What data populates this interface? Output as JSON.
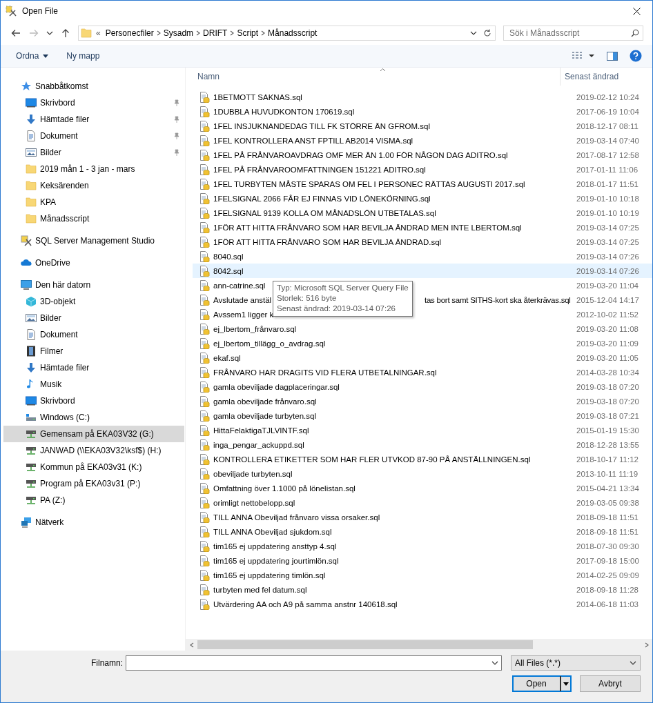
{
  "window": {
    "title": "Open File"
  },
  "address": {
    "overflow": "«",
    "path": [
      "Personecfiler",
      "Sysadm",
      "DRIFT",
      "Script",
      "Månadsscript"
    ]
  },
  "search": {
    "placeholder": "Sök i Månadsscript"
  },
  "toolbar": {
    "organize": "Ordna",
    "new_folder": "Ny mapp"
  },
  "sidebar": {
    "items": [
      {
        "label": "Snabbåtkomst",
        "kind": "star",
        "selected": false,
        "children": [
          {
            "label": "Skrivbord",
            "kind": "desktop",
            "pinned": true,
            "selected": false
          },
          {
            "label": "Hämtade filer",
            "kind": "download",
            "pinned": true,
            "selected": false
          },
          {
            "label": "Dokument",
            "kind": "document",
            "pinned": true,
            "selected": false
          },
          {
            "label": "Bilder",
            "kind": "pictures",
            "pinned": true,
            "selected": false
          },
          {
            "label": "2019 mån 1 - 3 jan - mars",
            "kind": "folder",
            "pinned": false,
            "selected": false
          },
          {
            "label": "Keksärenden",
            "kind": "folder",
            "pinned": false,
            "selected": false
          },
          {
            "label": "KPA",
            "kind": "folder",
            "pinned": false,
            "selected": false
          },
          {
            "label": "Månadsscript",
            "kind": "folder",
            "pinned": false,
            "selected": false
          }
        ]
      },
      {
        "label": "SQL Server Management Studio",
        "kind": "app",
        "selected": false
      },
      {
        "label": "OneDrive",
        "kind": "cloud",
        "selected": false
      },
      {
        "label": "Den här datorn",
        "kind": "computer",
        "selected": false,
        "children": [
          {
            "label": "3D-objekt",
            "kind": "cube",
            "selected": false
          },
          {
            "label": "Bilder",
            "kind": "pictures",
            "selected": false
          },
          {
            "label": "Dokument",
            "kind": "document",
            "selected": false
          },
          {
            "label": "Filmer",
            "kind": "film",
            "selected": false
          },
          {
            "label": "Hämtade filer",
            "kind": "download",
            "selected": false
          },
          {
            "label": "Musik",
            "kind": "music",
            "selected": false
          },
          {
            "label": "Skrivbord",
            "kind": "desktop",
            "selected": false
          },
          {
            "label": "Windows (C:)",
            "kind": "drive",
            "selected": false
          },
          {
            "label": "Gemensam på EKA03V32 (G:)",
            "kind": "netdrive",
            "selected": true
          },
          {
            "label": "JANWAD (\\\\EKA03V32\\ksf$) (H:)",
            "kind": "netdrive",
            "selected": false
          },
          {
            "label": "Kommun på EKA03v31 (K:)",
            "kind": "netdrive",
            "selected": false
          },
          {
            "label": "Program på EKA03v31 (P:)",
            "kind": "netdrive",
            "selected": false
          },
          {
            "label": "PA (Z:)",
            "kind": "netdrive",
            "selected": false
          }
        ]
      },
      {
        "label": "Nätverk",
        "kind": "network",
        "selected": false
      }
    ]
  },
  "columns": {
    "name": "Namn",
    "modified": "Senast ändrad"
  },
  "files": [
    {
      "name": "1BETMOTT SAKNAS.sql",
      "modified": "2019-02-12 10:24",
      "hovered": false
    },
    {
      "name": "1DUBBLA HUVUDKONTON 170619.sql",
      "modified": "2017-06-19 10:04",
      "hovered": false
    },
    {
      "name": "1FEL INSJUKNANDEDAG TILL FK STÖRRE ÄN GFROM.sql",
      "modified": "2018-12-17 08:11",
      "hovered": false
    },
    {
      "name": "1FEL KONTROLLERA ANST FPTILL AB2014 VISMA.sql",
      "modified": "2019-03-14 07:40",
      "hovered": false
    },
    {
      "name": "1FEL PÅ FRÅNVAROAVDRAG OMF MER ÄN 1.00 FÖR NÅGON DAG ADITRO.sql",
      "modified": "2017-08-17 12:58",
      "hovered": false
    },
    {
      "name": "1FEL PÅ FRÅNVAROOMFATTNINGEN 151221 ADITRO.sql",
      "modified": "2017-01-11 11:06",
      "hovered": false
    },
    {
      "name": "1FEL TURBYTEN MÅSTE SPARAS OM FEL I PERSONEC RÄTTAS AUGUSTI 2017.sql",
      "modified": "2018-01-17 11:51",
      "hovered": false
    },
    {
      "name": "1FELSIGNAL 2066 FÅR EJ FINNAS VID LÖNEKÖRNING.sql",
      "modified": "2019-01-10 10:18",
      "hovered": false
    },
    {
      "name": "1FELSIGNAL 9139 KOLLA OM MÅNADSLÖN UTBETALAS.sql",
      "modified": "2019-01-10 10:19",
      "hovered": false
    },
    {
      "name": "1FÖR ATT HITTA FRÅNVARO SOM HAR BEVILJA ÄNDRAD MEN INTE LBERTOM.sql",
      "modified": "2019-03-14 07:25",
      "hovered": false
    },
    {
      "name": "1FÖR ATT HITTA FRÅNVARO SOM HAR BEVILJA ÄNDRAD.sql",
      "modified": "2019-03-14 07:25",
      "hovered": false
    },
    {
      "name": "8040.sql",
      "modified": "2019-03-14 07:26",
      "hovered": false
    },
    {
      "name": "8042.sql",
      "modified": "2019-03-14 07:26",
      "hovered": true
    },
    {
      "name": "ann-catrine.sql",
      "modified": "2019-03-20 11:04",
      "hovered": false
    },
    {
      "name": "Avslutade anstäl",
      "name_end": "tas bort samt SITHS-kort ska återkrävas.sql",
      "modified": "2015-12-04 14:17",
      "hovered": false
    },
    {
      "name": "Avssem1 ligger k",
      "modified": "2012-10-02 11:52",
      "hovered": false
    },
    {
      "name": "ej_lbertom_frånvaro.sql",
      "modified": "2019-03-20 11:08",
      "hovered": false
    },
    {
      "name": "ej_lbertom_tillägg_o_avdrag.sql",
      "modified": "2019-03-20 11:09",
      "hovered": false
    },
    {
      "name": "ekaf.sql",
      "modified": "2019-03-20 11:05",
      "hovered": false
    },
    {
      "name": "FRÅNVARO HAR DRAGITS VID FLERA UTBETALNINGAR.sql",
      "modified": "2014-03-28 10:34",
      "hovered": false
    },
    {
      "name": "gamla obeviljade dagplaceringar.sql",
      "modified": "2019-03-18 07:20",
      "hovered": false
    },
    {
      "name": "gamla obeviljade frånvaro.sql",
      "modified": "2019-03-18 07:20",
      "hovered": false
    },
    {
      "name": "gamla obeviljade turbyten.sql",
      "modified": "2019-03-18 07:21",
      "hovered": false
    },
    {
      "name": "HittaFelaktigaTJLVINTF.sql",
      "modified": "2015-01-19 15:30",
      "hovered": false
    },
    {
      "name": "inga_pengar_ackuppd.sql",
      "modified": "2018-12-28 13:55",
      "hovered": false
    },
    {
      "name": "KONTROLLERA ETIKETTER SOM HAR FLER UTVKOD 87-90 PÅ ANSTÄLLNINGEN.sql",
      "modified": "2018-10-17 11:12",
      "hovered": false
    },
    {
      "name": "obeviljade turbyten.sql",
      "modified": "2013-10-11 11:19",
      "hovered": false
    },
    {
      "name": "Omfattning över 1.1000 på lönelistan.sql",
      "modified": "2015-04-21 13:34",
      "hovered": false
    },
    {
      "name": "orimligt nettobelopp.sql",
      "modified": "2019-03-05 09:38",
      "hovered": false
    },
    {
      "name": "TILL ANNA Obeviljad frånvaro vissa orsaker.sql",
      "modified": "2018-09-18 11:51",
      "hovered": false
    },
    {
      "name": "TILL ANNA Obeviljad sjukdom.sql",
      "modified": "2018-09-18 11:51",
      "hovered": false
    },
    {
      "name": "tim165 ej uppdatering ansttyp 4.sql",
      "modified": "2018-07-30 09:30",
      "hovered": false
    },
    {
      "name": "tim165 ej uppdatering jourtimlön.sql",
      "modified": "2017-09-18 15:00",
      "hovered": false
    },
    {
      "name": "tim165 ej uppdatering timlön.sql",
      "modified": "2014-02-25 09:09",
      "hovered": false
    },
    {
      "name": "turbyten med fel datum.sql",
      "modified": "2018-09-18 11:28",
      "hovered": false
    },
    {
      "name": "Utvärdering AA och A9 på samma anstnr 140618.sql",
      "modified": "2014-06-18 11:03",
      "hovered": false
    }
  ],
  "tooltip": {
    "lines": [
      "Typ: Microsoft SQL Server Query File",
      "Storlek: 516 byte",
      "Senast ändrad: 2019-03-14 07:26"
    ]
  },
  "footer": {
    "filename_label": "Filnamn:",
    "file_type": "All Files (*.*)",
    "open": "Open",
    "cancel": "Avbryt"
  }
}
